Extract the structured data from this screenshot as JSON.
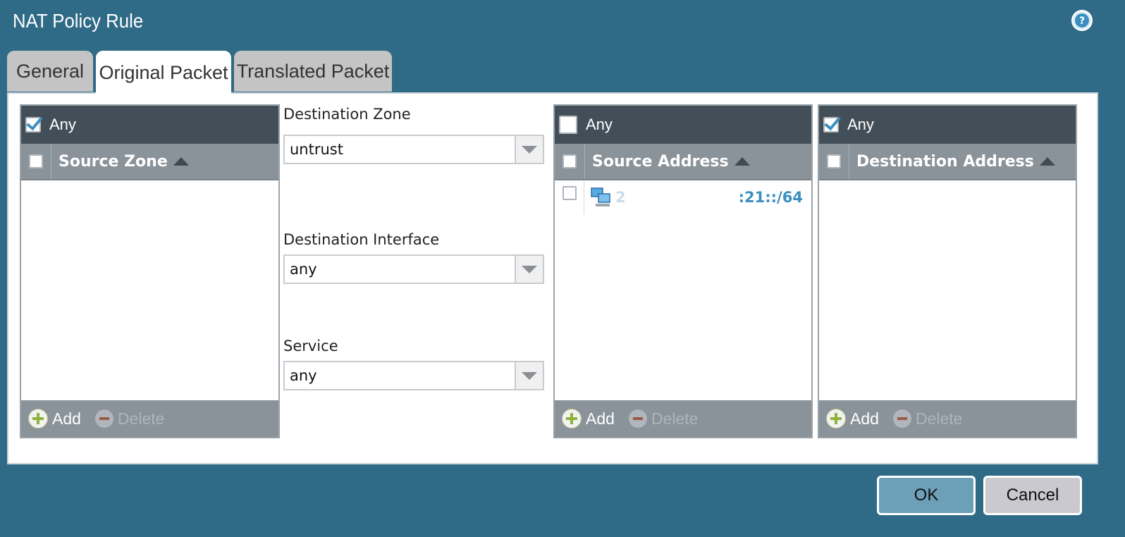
{
  "dialog": {
    "title": "NAT Policy Rule"
  },
  "tabs": [
    {
      "label": "General",
      "active": false
    },
    {
      "label": "Original Packet",
      "active": true
    },
    {
      "label": "Translated Packet",
      "active": false
    }
  ],
  "source_zone": {
    "any_label": "Any",
    "any_checked": true,
    "column": "Source Zone",
    "rows": [],
    "add_label": "Add",
    "delete_label": "Delete"
  },
  "destination": {
    "zone_label": "Destination Zone",
    "zone_value": "untrust",
    "interface_label": "Destination Interface",
    "interface_value": "any",
    "service_label": "Service",
    "service_value": "any"
  },
  "source_address": {
    "any_label": "Any",
    "any_checked": false,
    "column": "Source Address",
    "rows": [
      {
        "prefix": "2",
        "suffix": ":21::/64",
        "icon": "network-address-icon"
      }
    ],
    "add_label": "Add",
    "delete_label": "Delete"
  },
  "destination_address": {
    "any_label": "Any",
    "any_checked": true,
    "column": "Destination Address",
    "rows": [],
    "add_label": "Add",
    "delete_label": "Delete"
  },
  "buttons": {
    "ok": "OK",
    "cancel": "Cancel"
  },
  "colors": {
    "background": "#2f6a87",
    "header": "#434f58",
    "column_header": "#8a929a",
    "link": "#3a8fc0",
    "ok_button": "#6d9fb9"
  }
}
